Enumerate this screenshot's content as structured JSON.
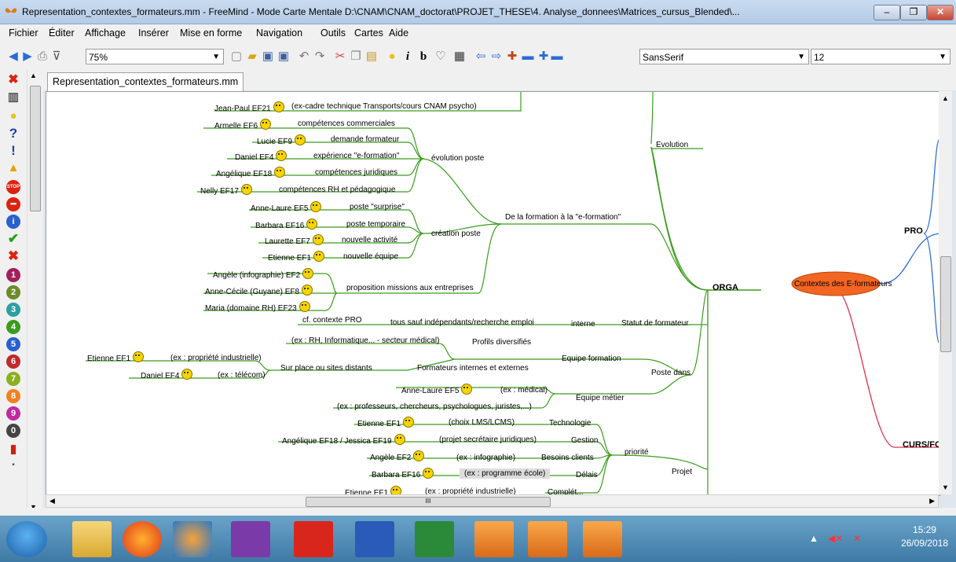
{
  "window": {
    "title": "Representation_contextes_formateurs.mm - FreeMind - Mode Carte Mentale D:\\CNAM\\CNAM_doctorat\\PROJET_THESE\\4. Analyse_donnees\\Matrices_cursus_Blended\\...",
    "minimize": "–",
    "maximize": "❐",
    "close": "✕"
  },
  "menu": [
    "Fichier",
    "Éditer",
    "Affichage",
    "Insérer",
    "Mise en forme",
    "Navigation",
    "Outils",
    "Cartes",
    "Aide"
  ],
  "toolbar": {
    "zoom": "75%",
    "font": "SansSerif",
    "size": "12"
  },
  "tab": {
    "label": "Representation_contextes_formateurs.mm"
  },
  "map": {
    "center": "Contextes des E-formateurs",
    "pro": "PRO",
    "curs": "CURS/FO",
    "orga": "ORGA",
    "evolution": "Evolution",
    "jeanpaul": "Jean-Paul EF21",
    "jeanpaul_note": "(ex-cadre technique Transports/cours CNAM psycho)",
    "armelle": "Armelle EF6",
    "armelle_note": "compétences commerciales",
    "lucie": "Lucie EF9",
    "lucie_note": "demande formateur",
    "daniel4": "Daniel EF4",
    "daniel4_note": "expérience \"e-formation\"",
    "angelique": "Angélique EF18",
    "angelique_note": "compétences juridiques",
    "nelly": "Nelly EF17",
    "nelly_note": "compétences RH et pédagogique",
    "evolution_poste": "évolution poste",
    "annelaure": "Anne-Laure EF5",
    "annelaure_note": "poste \"surprise\"",
    "barbara": "Barbara EF16",
    "barbara_note": "poste temporaire",
    "laurette": "Laurette EF7",
    "laurette_note": "nouvelle activité",
    "etienne": "Etienne EF1",
    "etienne_note": "nouvelle équipe",
    "creation_poste": "création poste",
    "de_la_formation": "De la formation à la \"e-formation\"",
    "angele2": "Angèle (infographie) EF2",
    "annececile": "Anne-Cécile (Guyane) EF8",
    "maria": "Maria (domaine RH)  EF23",
    "proposition": "proposition missions aux entreprises",
    "cf_pro": "cf. contexte PRO",
    "tous_sauf": "tous sauf indépendants/recherche emploi",
    "interne": "interne",
    "statut": "Statut de formateur",
    "ex_rh": "(ex : RH, Informatique... - secteur médical)",
    "profils": "Profils diversifiés",
    "etienne_b": "Etienne EF1",
    "ex_propriete": "(ex : propriété industrielle)",
    "daniel_b": "Daniel EF4",
    "ex_telecom": "(ex : télécom)",
    "sur_place": "Sur place ou sites distants",
    "formateurs": "Formateurs internes et externes",
    "equipe_formation": "Equipe formation",
    "poste_dans": "Poste dans",
    "annelaure_b": "Anne-Laure EF5",
    "ex_medical": "(ex : médical)",
    "equipe_metier": "Equipe métier",
    "ex_prof": "(ex : professeurs, chercheurs, psychologues, juristes,...)",
    "etienne_c": "Etienne EF1",
    "choix_lms": "(choix LMS/LCMS)",
    "technologie": "Technologie",
    "angelique_jessica": "Angélique EF18 / Jessica EF19",
    "projet_secr": "(projet secrétaire juridiques)",
    "gestion": "Gestion",
    "angele_c": "Angèle EF2",
    "ex_infographie": "(ex : infographie)",
    "besoins": "Besoins clients",
    "priorite": "priorité",
    "barbara_c": "Barbara EF16",
    "ex_programme": "(ex : programme école)",
    "delais": "Délais",
    "projet": "Projet",
    "etienne_d": "Etienne EF1",
    "ex_propriete2": "(ex : propriété industrielle)",
    "complete": "Complét..."
  },
  "scroll_thumb": "III",
  "taskbar": {
    "time": "15:29",
    "date": "26/09/2018"
  },
  "colors": {
    "green": "#3a9c1c",
    "blue": "#2f6fd6",
    "red": "#e0304a",
    "center": "#f26522"
  }
}
